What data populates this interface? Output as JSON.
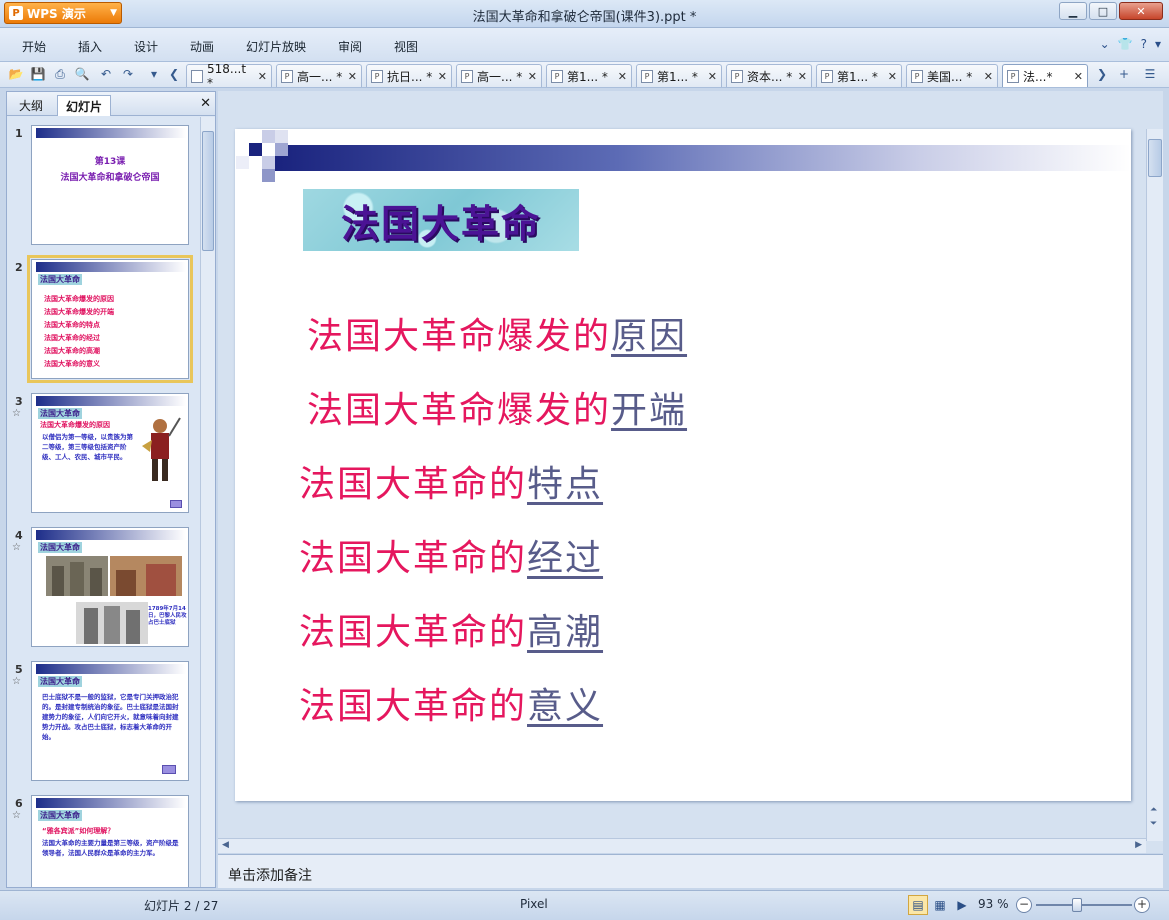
{
  "app": {
    "name": "WPS 演示",
    "window_title": "法国大革命和拿破仑帝国(课件3).ppt *"
  },
  "menu": [
    "开始",
    "插入",
    "设计",
    "动画",
    "幻灯片放映",
    "审阅",
    "视图"
  ],
  "doc_tabs": [
    {
      "label": "518...t *"
    },
    {
      "label": "高一... *"
    },
    {
      "label": "抗日... *"
    },
    {
      "label": "高一... *"
    },
    {
      "label": "第1... *"
    },
    {
      "label": "第1... *"
    },
    {
      "label": "资本... *"
    },
    {
      "label": "第1... *"
    },
    {
      "label": "美国... *"
    },
    {
      "label": "法...*"
    }
  ],
  "left_panel": {
    "tab_outline": "大纲",
    "tab_slides": "幻灯片"
  },
  "thumbnails": [
    {
      "num": "1",
      "line1": "第13课",
      "line2": "法国大革命和拿破仑帝国"
    },
    {
      "num": "2",
      "title": "法国大革命",
      "lines": [
        "法国大革命爆发的原因",
        "法国大革命爆发的开端",
        "法国大革命的特点",
        "法国大革命的经过",
        "法国大革命的高潮",
        "法国大革命的意义"
      ]
    },
    {
      "num": "3",
      "title": "法国大革命",
      "sub": "法国大革命爆发的原因",
      "body": "以僧侣为第一等级，以贵族为第二等级，第三等级包括资产阶级、工人、农民、城市平民。"
    },
    {
      "num": "4",
      "title": "法国大革命",
      "caption": "1789年7月14日，巴黎人民攻占巴士底狱"
    },
    {
      "num": "5",
      "title": "法国大革命",
      "body": "巴士底狱不是一般的监狱，它是专门关押政治犯的。是封建专制统治的象征。巴士底狱是法国封建势力的象征，人们向它开火，就意味着向封建势力开战。攻占巴士底狱，标志着大革命的开始。"
    },
    {
      "num": "6",
      "title": "法国大革命",
      "sub": "“雅各宾派”如何理解？",
      "body": "法国大革命的主要力量是第三等级，资产阶级是领导者，法国人民群众是革命的主力军。"
    }
  ],
  "slide": {
    "title": "法国大革命",
    "items": [
      {
        "text": "法国大革命爆发的",
        "link": "原因"
      },
      {
        "text": "法国大革命爆发的",
        "link": "开端"
      },
      {
        "text": "法国大革命的",
        "link": "特点"
      },
      {
        "text": "法国大革命的",
        "link": "经过"
      },
      {
        "text": "法国大革命的",
        "link": "高潮"
      },
      {
        "text": "法国大革命的",
        "link": "意义"
      }
    ]
  },
  "notes_placeholder": "单击添加备注",
  "status": {
    "slide_position": "幻灯片 2 / 27",
    "theme": "Pixel",
    "zoom": "93 %"
  },
  "colors": {
    "accent_orange": "#ec7a07",
    "item_red": "#e5175e",
    "link_gray": "#585c8a",
    "title_purple": "#4b1395"
  }
}
